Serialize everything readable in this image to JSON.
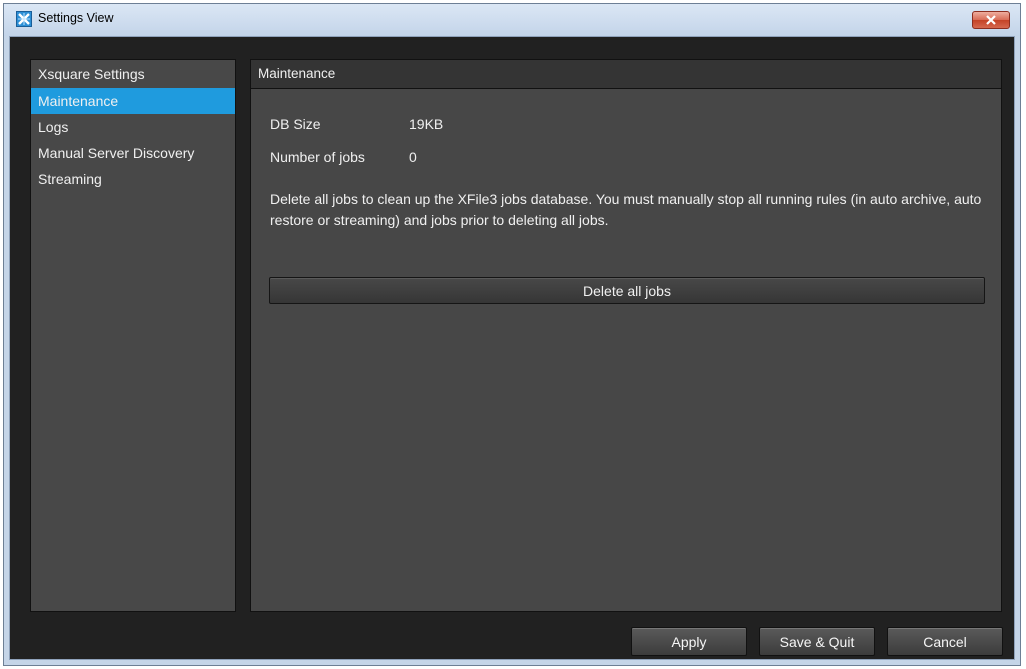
{
  "window": {
    "title": "Settings View",
    "app_icon": "xfile-app-icon",
    "close_icon": "close-x-icon"
  },
  "sidebar": {
    "header": "Xsquare Settings",
    "items": [
      {
        "label": "Maintenance",
        "active": true
      },
      {
        "label": "Logs",
        "active": false
      },
      {
        "label": "Manual Server Discovery",
        "active": false
      },
      {
        "label": "Streaming",
        "active": false
      }
    ]
  },
  "panel": {
    "title": "Maintenance",
    "db_size_label": "DB Size",
    "db_size_value": "19KB",
    "jobs_label": "Number of jobs",
    "jobs_value": "0",
    "description": "Delete all jobs to clean up the XFile3 jobs database. You must manually stop all running rules (in auto archive, auto restore or streaming) and jobs prior to deleting all jobs.",
    "delete_button": "Delete all jobs"
  },
  "footer": {
    "apply": "Apply",
    "save_quit": "Save & Quit",
    "cancel": "Cancel"
  },
  "colors": {
    "accent": "#1f9bde",
    "panel_bg": "#474747",
    "window_bg": "#212121",
    "close_red": "#c44226"
  }
}
